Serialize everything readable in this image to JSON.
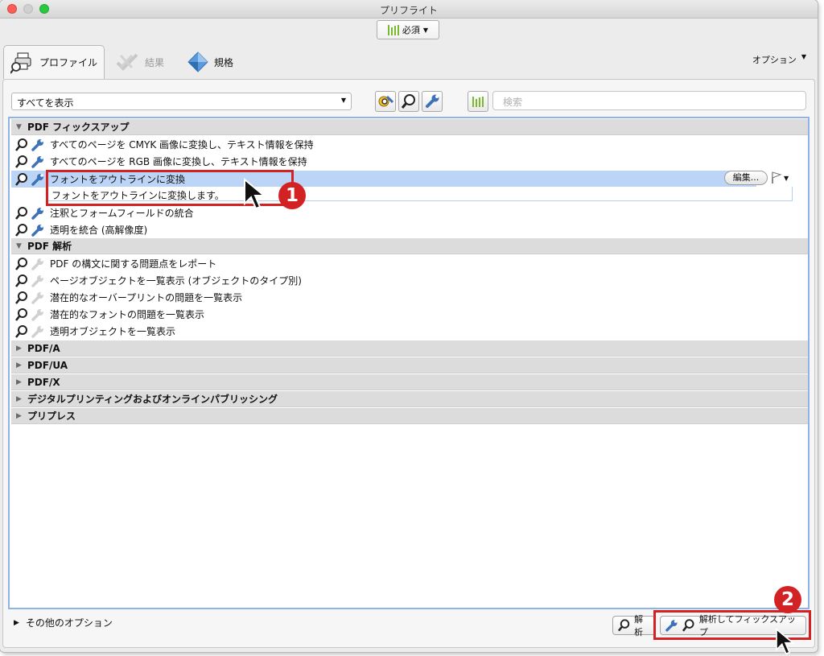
{
  "window": {
    "title": "プリフライト",
    "required_label": "必須"
  },
  "tabs": [
    {
      "label": "プロファイル",
      "icon": "profile-printer-icon",
      "active": true
    },
    {
      "label": "結果",
      "icon": "results-check-icon",
      "active": false
    },
    {
      "label": "規格",
      "icon": "standards-diamond-icon",
      "active": false
    }
  ],
  "options_menu": "オプション",
  "toolbar": {
    "filter_value": "すべてを表示",
    "search_placeholder": "検索"
  },
  "groups": [
    {
      "title": "PDF フィックスアップ",
      "expanded": true,
      "items": [
        {
          "label": "すべてのページを CMYK 画像に変換し、テキスト情報を保持"
        },
        {
          "label": "すべてのページを RGB 画像に変換し、テキスト情報を保持"
        },
        {
          "label": "フォントをアウトラインに変換",
          "selected": true,
          "description": "フォントをアウトラインに変換します。"
        },
        {
          "label": "注釈とフォームフィールドの統合"
        },
        {
          "label": "透明を統合 (高解像度)"
        }
      ]
    },
    {
      "title": "PDF 解析",
      "expanded": true,
      "items": [
        {
          "label": "PDF の構文に関する問題点をレポート"
        },
        {
          "label": "ページオブジェクトを一覧表示 (オブジェクトのタイプ別)"
        },
        {
          "label": "潜在的なオーバープリントの問題を一覧表示"
        },
        {
          "label": "潜在的なフォントの問題を一覧表示"
        },
        {
          "label": "透明オブジェクトを一覧表示"
        }
      ]
    },
    {
      "title": "PDF/A",
      "expanded": false
    },
    {
      "title": "PDF/UA",
      "expanded": false
    },
    {
      "title": "PDF/X",
      "expanded": false
    },
    {
      "title": "デジタルプリンティングおよびオンラインパブリッシング",
      "expanded": false
    },
    {
      "title": "プリプレス",
      "expanded": false
    }
  ],
  "edit_button": "編集...",
  "more_options": "その他のオプション",
  "buttons": {
    "analyze": "解析",
    "analyze_fix": "解析してフィックスアップ"
  },
  "annotations": {
    "badge1": "1",
    "badge2": "2",
    "color": "#d32224"
  }
}
